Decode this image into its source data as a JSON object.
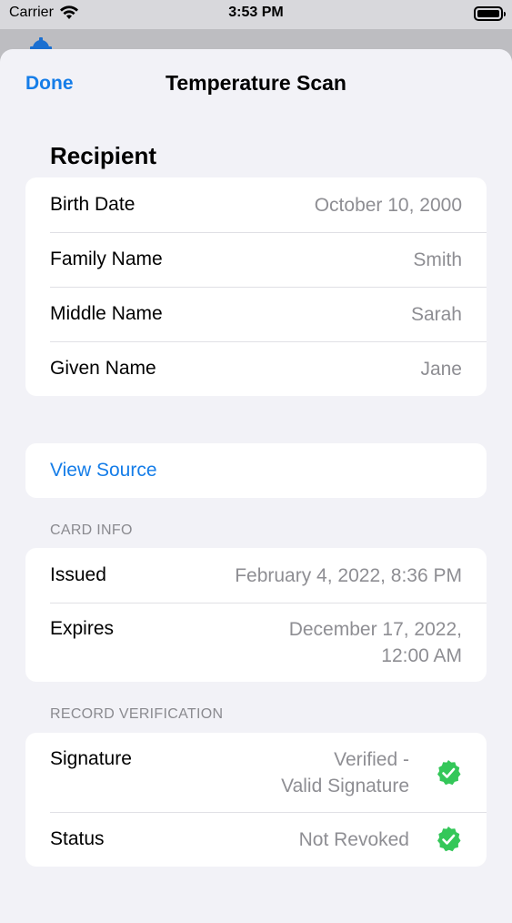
{
  "status_bar": {
    "carrier": "Carrier",
    "time": "3:53 PM"
  },
  "nav": {
    "done_label": "Done",
    "title": "Temperature Scan"
  },
  "recipient": {
    "title": "Recipient",
    "rows": [
      {
        "label": "Birth Date",
        "value": "October 10, 2000"
      },
      {
        "label": "Family Name",
        "value": "Smith"
      },
      {
        "label": "Middle Name",
        "value": "Sarah"
      },
      {
        "label": "Given Name",
        "value": "Jane"
      }
    ]
  },
  "view_source_label": "View Source",
  "card_info": {
    "header": "CARD INFO",
    "issued_label": "Issued",
    "issued_value": "February 4, 2022, 8:36 PM",
    "expires_label": "Expires",
    "expires_value_line1": "December 17, 2022,",
    "expires_value_line2": "12:00 AM"
  },
  "record_verification": {
    "header": "RECORD VERIFICATION",
    "signature_label": "Signature",
    "signature_value_line1": "Verified -",
    "signature_value_line2": "Valid Signature",
    "status_label": "Status",
    "status_value": "Not Revoked"
  },
  "colors": {
    "accent": "#157de8",
    "check": "#34c759"
  },
  "icons": {
    "wifi": "wifi-icon",
    "battery": "battery-icon",
    "gear": "gear-icon",
    "verified": "verified-check-icon"
  }
}
